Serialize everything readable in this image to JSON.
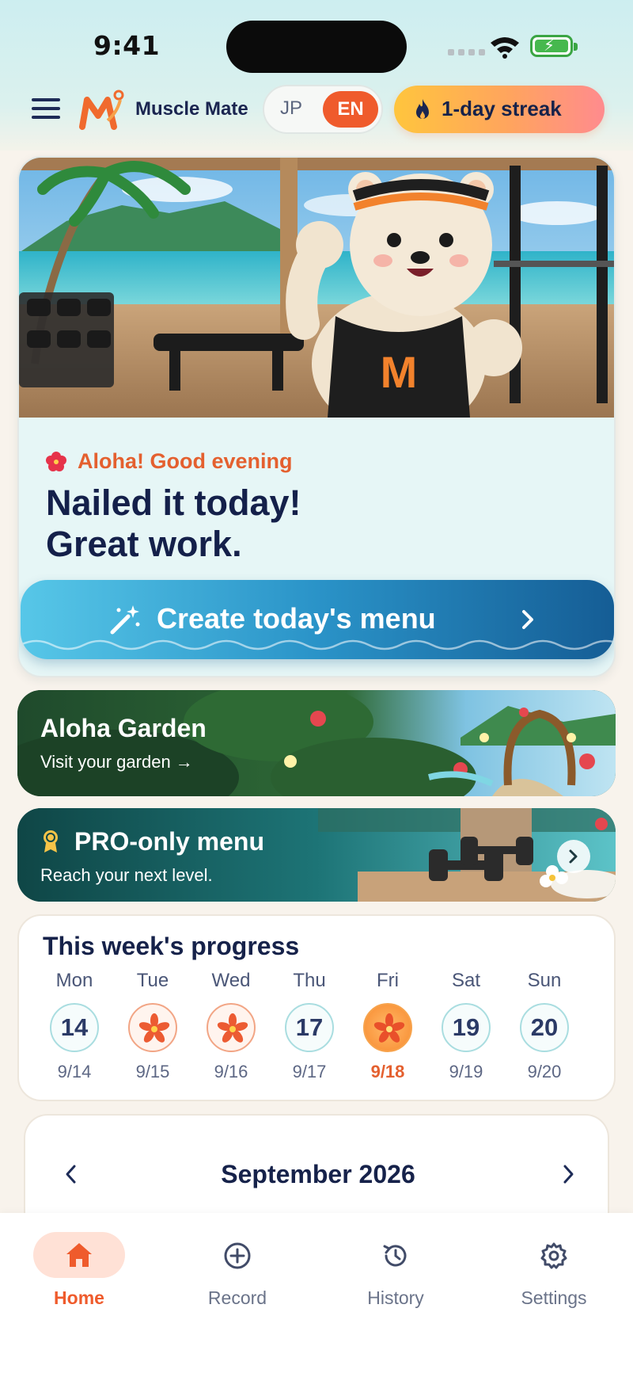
{
  "status": {
    "time": "9:41"
  },
  "header": {
    "app_name": "Muscle Mate",
    "lang": {
      "jp": "JP",
      "en": "EN",
      "selected": "EN"
    },
    "streak": "1-day streak"
  },
  "hero": {
    "greeting": "Aloha! Good evening",
    "title_line1": "Nailed it today!",
    "title_line2": "Great work.",
    "cta_label": "Create today's menu",
    "mascot_shirt_letter": "M"
  },
  "garden": {
    "title": "Aloha Garden",
    "subtitle": "Visit your garden →"
  },
  "pro": {
    "title": "PRO-only menu",
    "subtitle": "Reach your next level."
  },
  "week": {
    "title": "This week's progress",
    "days": [
      {
        "name": "Mon",
        "number": "14",
        "date": "9/14",
        "state": "empty"
      },
      {
        "name": "Tue",
        "number": "15",
        "date": "9/15",
        "state": "done"
      },
      {
        "name": "Wed",
        "number": "16",
        "date": "9/16",
        "state": "done"
      },
      {
        "name": "Thu",
        "number": "17",
        "date": "9/17",
        "state": "empty"
      },
      {
        "name": "Fri",
        "number": "18",
        "date": "9/18",
        "state": "today"
      },
      {
        "name": "Sat",
        "number": "19",
        "date": "9/19",
        "state": "empty"
      },
      {
        "name": "Sun",
        "number": "20",
        "date": "9/20",
        "state": "empty"
      }
    ]
  },
  "calendar": {
    "month": "September 2026"
  },
  "tabs": [
    {
      "label": "Home",
      "icon": "home-icon",
      "active": true
    },
    {
      "label": "Record",
      "icon": "plus-circle-icon",
      "active": false
    },
    {
      "label": "History",
      "icon": "history-icon",
      "active": false
    },
    {
      "label": "Settings",
      "icon": "gear-icon",
      "active": false
    }
  ],
  "colors": {
    "accent": "#ef5b2c",
    "navy": "#16224a",
    "cta_start": "#57c7e8",
    "cta_end": "#155d95"
  }
}
